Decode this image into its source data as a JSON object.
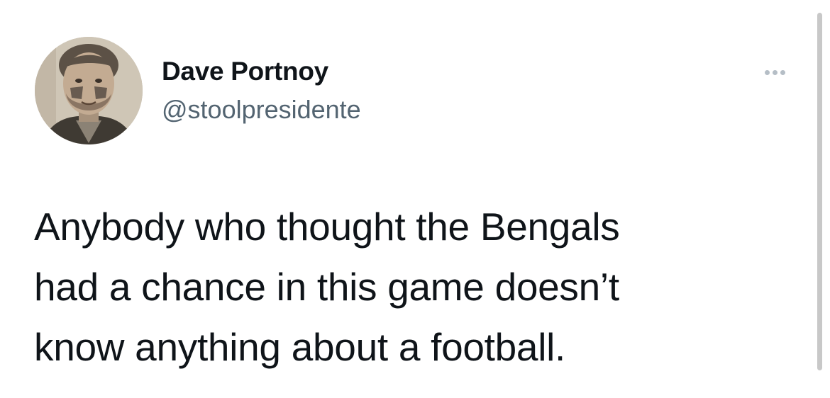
{
  "author": {
    "name": "Dave Portnoy",
    "handle": "@stoolpresidente"
  },
  "tweet": {
    "text": "Anybody who thought the Bengals\nhad a chance in this game doesn’t\nknow anything about a football."
  },
  "icons": {
    "more": "more-horizontal-icon",
    "avatar": "profile-photo"
  },
  "colors": {
    "text_primary": "#0f1419",
    "text_secondary": "#536471",
    "icon_muted": "#b5bec6",
    "background": "#ffffff",
    "scrollbar": "#c8c8c8"
  }
}
